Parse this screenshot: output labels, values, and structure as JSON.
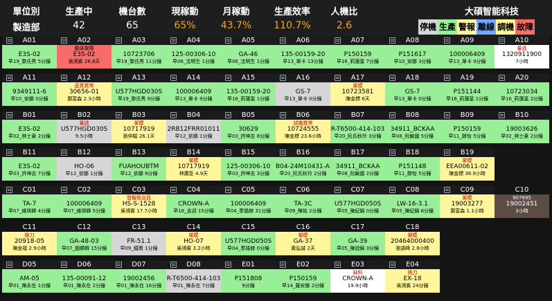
{
  "header": {
    "labels": [
      "單位別",
      "生產中",
      "機台數",
      "現稼動",
      "月稼動",
      "生產效率",
      "人機比"
    ],
    "values": [
      "製造部",
      "42",
      "65",
      "65%",
      "43.7%",
      "110.7%",
      "2.6"
    ],
    "company": "大碩智能科技"
  },
  "legend": [
    {
      "label": "停機",
      "color": "#d6d6d6"
    },
    {
      "label": "生產",
      "color": "#98ef98"
    },
    {
      "label": "警報",
      "color": "#fff59a"
    },
    {
      "label": "離線",
      "color": "#6fa8ff"
    },
    {
      "label": "調機",
      "color": "#fff59a"
    },
    {
      "label": "故障",
      "color": "#f76b6b"
    }
  ],
  "rows": [
    [
      {
        "id": "A01",
        "status": "",
        "main": "E3S-02",
        "sub": "早19_黎氏秀 5分鐘",
        "color": "g"
      },
      {
        "id": "A02",
        "status": "",
        "main": "E3S-02",
        "sub": "吳鴻賓 28.8天",
        "color": "r",
        "top": "銑床故障"
      },
      {
        "id": "A03",
        "status": "",
        "main": "10723706",
        "sub": "早19_黎氏秀 11分鐘",
        "color": "g"
      },
      {
        "id": "A04",
        "status": "",
        "main": "125-00306-10",
        "sub": "早06_沈明生 1分鐘",
        "color": "g"
      },
      {
        "id": "A05",
        "status": "",
        "main": "GA-46",
        "sub": "早06_沈明生 1分鐘",
        "color": "g"
      },
      {
        "id": "A06",
        "status": "",
        "main": "135-00159-20",
        "sub": "早13_單卡 13分鐘",
        "color": "g"
      },
      {
        "id": "A07",
        "status": "",
        "main": "P150159",
        "sub": "早16_莉蓮葉 7分鐘",
        "color": "g"
      },
      {
        "id": "A08",
        "status": "",
        "main": "P151617",
        "sub": "早10_安娜 3分鐘",
        "color": "g"
      },
      {
        "id": "A09",
        "status": "",
        "main": "100006409",
        "sub": "早13_單卡 9分鐘",
        "color": "g"
      },
      {
        "id": "A10",
        "status": "量逃",
        "main": "1320911900",
        "sub": "7小時",
        "color": "w"
      }
    ],
    [
      {
        "id": "A11",
        "status": "",
        "main": "9349111-6",
        "sub": "早10_安娜 0分鐘",
        "color": "g"
      },
      {
        "id": "A12",
        "status": "品質異常",
        "main": "30656-01",
        "sub": "鄭富森 2.3小時",
        "color": "y"
      },
      {
        "id": "A13",
        "status": "",
        "main": "U577HGD030S",
        "sub": "早19_黎氏秀 9分鐘",
        "color": "g"
      },
      {
        "id": "A14",
        "status": "",
        "main": "100006409",
        "sub": "早13_單卡 9分鐘",
        "color": "g"
      },
      {
        "id": "A15",
        "status": "",
        "main": "135-00159-20",
        "sub": "早16_莉蓮葉 1分鐘",
        "color": "g"
      },
      {
        "id": "A16",
        "status": "",
        "main": "GS-7",
        "sub": "早13_單卡 0分鐘",
        "color": "s"
      },
      {
        "id": "A17",
        "status": "架模",
        "main": "10723581",
        "sub": "陳金標 6天",
        "color": "y"
      },
      {
        "id": "A18",
        "status": "",
        "main": "GS-7",
        "sub": "早13_單卡 0分鐘",
        "color": "g"
      },
      {
        "id": "A19",
        "status": "",
        "main": "P151144",
        "sub": "早16_莉蓮葉 1分鐘",
        "color": "g"
      },
      {
        "id": "A20",
        "status": "",
        "main": "10723034",
        "sub": "早16_莉蓮葉 2分鐘",
        "color": "g"
      }
    ],
    [
      {
        "id": "B01",
        "status": "",
        "main": "E3S-02",
        "sub": "早02_林士豪 2分鐘",
        "color": "g"
      },
      {
        "id": "B02",
        "status": "量逃",
        "main": "U577HGD030S",
        "sub": "9.5小時",
        "color": "s"
      },
      {
        "id": "B03",
        "status": "架模",
        "main": "10717919",
        "sub": "張仲駿 26.1天",
        "color": "y"
      },
      {
        "id": "B04",
        "status": "",
        "main": "2RB12FRR01011",
        "sub": "早12_依娜 1分鐘",
        "color": "s"
      },
      {
        "id": "B05",
        "status": "",
        "main": "30629",
        "sub": "早03_許坤志 8分鐘",
        "color": "g"
      },
      {
        "id": "B06",
        "status": "試機異常",
        "main": "10724555",
        "sub": "陳金標 23.6小時",
        "color": "y"
      },
      {
        "id": "B07",
        "status": "",
        "main": "R-T6500-414-103",
        "sub": "早20_阮氏秋玲 3分鐘",
        "color": "g"
      },
      {
        "id": "B08",
        "status": "",
        "main": "34911_BCKAA",
        "sub": "早08_阮輸國 5分鐘",
        "color": "g"
      },
      {
        "id": "B09",
        "status": "",
        "main": "P150159",
        "sub": "早11_靜怡 5分鐘",
        "color": "g"
      },
      {
        "id": "B10",
        "status": "",
        "main": "19003626",
        "sub": "早02_林士豪 2分鐘",
        "color": "g"
      }
    ],
    [
      {
        "id": "B11",
        "status": "",
        "main": "E3S-02",
        "sub": "早03_許坤志 7分鐘",
        "color": "g"
      },
      {
        "id": "B12",
        "status": "",
        "main": "HO-06",
        "sub": "早12_依娜 1分鐘",
        "color": "s"
      },
      {
        "id": "B13",
        "status": "",
        "main": "FUAHOUBTM",
        "sub": "早12_依娜 8分鐘",
        "color": "g"
      },
      {
        "id": "B14",
        "status": "架模",
        "main": "10717919",
        "sub": "林廣臣 4.9天",
        "color": "y"
      },
      {
        "id": "B15",
        "status": "",
        "main": "125-00306-10",
        "sub": "早03_許坤志 3分鐘",
        "color": "g"
      },
      {
        "id": "B16",
        "status": "",
        "main": "B04-24M10431-A304",
        "sub": "早20_阮氏秋玲 2分鐘",
        "color": "g"
      },
      {
        "id": "B17",
        "status": "",
        "main": "34911_BCKAA",
        "sub": "早08_阮輸國 2分鐘",
        "color": "g"
      },
      {
        "id": "B18",
        "status": "",
        "main": "P151148",
        "sub": "早11_靜怡 5分鐘",
        "color": "g"
      },
      {
        "id": "B19",
        "status": "架模",
        "main": "EEA00611-02",
        "sub": "陳金標 38.9小時",
        "color": "y"
      },
      {
        "id": "",
        "status": "",
        "main": "",
        "sub": "",
        "color": "dk"
      }
    ],
    [
      {
        "id": "C01",
        "status": "",
        "main": "TA-7",
        "sub": "早07_維琪韓 4分鐘",
        "color": "g"
      },
      {
        "id": "C02",
        "status": "",
        "main": "100006409",
        "sub": "早07_維琪韓 5分鐘",
        "color": "g"
      },
      {
        "id": "C03",
        "status": "發擬恢治具",
        "main": "HS-S-1528",
        "sub": "吳鴻賓 17.7小時",
        "color": "y"
      },
      {
        "id": "C04",
        "status": "",
        "main": "CROWN-A",
        "sub": "早18_吉迎 15分鐘",
        "color": "g"
      },
      {
        "id": "C05",
        "status": "",
        "main": "100006409",
        "sub": "早04_季諾赫 31分鐘",
        "color": "g"
      },
      {
        "id": "C06",
        "status": "",
        "main": "TA-3C",
        "sub": "早09_陳祐 2分鐘",
        "color": "g"
      },
      {
        "id": "C07",
        "status": "",
        "main": "U577HGD050S",
        "sub": "早05_陳紀錦 0分鐘",
        "color": "g"
      },
      {
        "id": "C08",
        "status": "",
        "main": "LW-16-3.1",
        "sub": "早05_陳紀錦 6分鐘",
        "color": "g"
      },
      {
        "id": "C09",
        "status": "架模",
        "main": "19003277",
        "sub": "鄭富森 1.1小時",
        "color": "y"
      },
      {
        "id": "C10",
        "status": "907695",
        "main": "19002451",
        "sub": "3小時",
        "color": "b"
      }
    ],
    [
      {
        "id": "C11",
        "status": "換刀",
        "main": "20918-05",
        "sub": "陳金福 2.9小時",
        "color": "y"
      },
      {
        "id": "C12",
        "status": "",
        "main": "GA-48-03",
        "sub": "早07_趙鐸韓 15分鐘",
        "color": "g"
      },
      {
        "id": "C13",
        "status": "",
        "main": "FR-51.1",
        "sub": "早09_鐵熹 1分鐘",
        "color": "s"
      },
      {
        "id": "C14",
        "status": "架模",
        "main": "HO-07",
        "sub": "吳鴻賓 3.2小時",
        "color": "y"
      },
      {
        "id": "C15",
        "status": "",
        "main": "U577HGD050S",
        "sub": "早04_季諾赫 0分鐘",
        "color": "g"
      },
      {
        "id": "C16",
        "status": "架模",
        "main": "GA-37",
        "sub": "黃弘誠 2天",
        "color": "y"
      },
      {
        "id": "C17",
        "status": "",
        "main": "GA-39",
        "sub": "早05_陳冠錦 3分鐘",
        "color": "g"
      },
      {
        "id": "C18",
        "status": "架模",
        "main": "20464000400",
        "sub": "張語峰 2.8小時",
        "color": "y"
      },
      {
        "id": "",
        "status": "",
        "main": "",
        "sub": "",
        "color": "dk"
      },
      {
        "id": "",
        "status": "",
        "main": "",
        "sub": "",
        "color": "dk"
      }
    ],
    [
      {
        "id": "D05",
        "status": "",
        "main": "AM-05",
        "sub": "早01_陳永在 1分鐘",
        "color": "g"
      },
      {
        "id": "D06",
        "status": "",
        "main": "135-00091-12",
        "sub": "早01_陳永在 2分鐘",
        "color": "g"
      },
      {
        "id": "D07",
        "status": "",
        "main": "19002456",
        "sub": "早01_陳永在 16分鐘",
        "color": "g"
      },
      {
        "id": "D08",
        "status": "",
        "main": "R-T6500-414-103",
        "sub": "早01_陳永在 7分鐘",
        "color": "s"
      },
      {
        "id": "E01",
        "status": "",
        "main": "P151808",
        "sub": "9分鐘",
        "color": "g"
      },
      {
        "id": "E02",
        "status": "",
        "main": "P150159",
        "sub": "早14_薩安娜 2分鐘",
        "color": "g"
      },
      {
        "id": "E03",
        "status": "缺料",
        "main": "CROWN-A",
        "sub": "19.9小時",
        "color": "w"
      },
      {
        "id": "E04",
        "status": "換刀",
        "main": "EX-18",
        "sub": "吳鴻賓 24分鐘",
        "color": "y"
      },
      {
        "id": "",
        "status": "",
        "main": "",
        "sub": "",
        "color": "dk"
      },
      {
        "id": "",
        "status": "",
        "main": "",
        "sub": "",
        "color": "dk"
      }
    ]
  ]
}
